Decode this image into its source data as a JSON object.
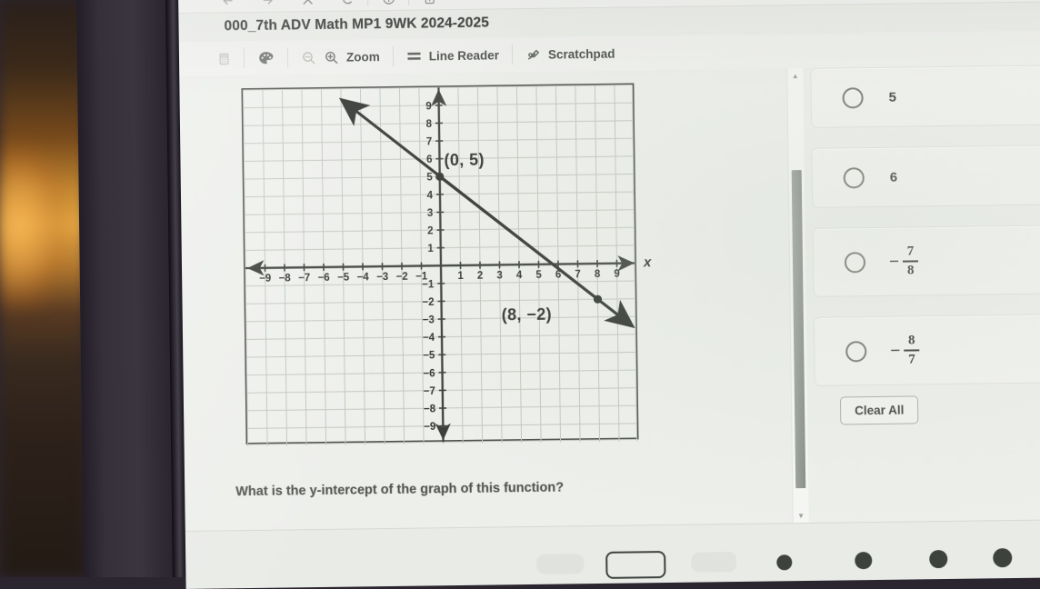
{
  "browser": {
    "controls": [
      {
        "name": "back-icon",
        "label": "Back"
      },
      {
        "name": "forward-icon",
        "label": "Forward"
      },
      {
        "name": "close-icon",
        "label": "Close"
      },
      {
        "name": "reload-icon",
        "label": "Reload"
      },
      {
        "name": "info-icon",
        "label": "Info"
      },
      {
        "name": "new-page-icon",
        "label": "New Page"
      }
    ]
  },
  "assessment": {
    "title": "000_7th ADV Math MP1 9WK 2024-2025"
  },
  "toolbar": {
    "calculator_icon": "calculator-icon",
    "palette_icon": "palette-icon",
    "zoom_out_icon": "zoom-out-icon",
    "zoom_in_icon": "zoom-in-icon",
    "zoom_label": "Zoom",
    "line_reader_icon": "line-reader-icon",
    "line_reader_label": "Line Reader",
    "scratchpad_icon": "scratchpad-icon",
    "scratchpad_label": "Scratchpad"
  },
  "question": {
    "text": "What is the y-intercept of the graph of this function?"
  },
  "answers": {
    "options": [
      {
        "id": "opt-5",
        "type": "plain",
        "label": "5"
      },
      {
        "id": "opt-6",
        "type": "plain",
        "label": "6"
      },
      {
        "id": "opt-78",
        "type": "fraction",
        "sign": "−",
        "numerator": "7",
        "denominator": "8",
        "label": "-7/8"
      },
      {
        "id": "opt-87",
        "type": "fraction",
        "sign": "−",
        "numerator": "8",
        "denominator": "7",
        "label": "-8/7"
      }
    ],
    "selected": null,
    "clear_all_label": "Clear All"
  },
  "chart_data": {
    "type": "line",
    "title": "",
    "xlabel": "x",
    "ylabel": "",
    "xlim": [
      -10,
      10
    ],
    "ylim": [
      -10,
      10
    ],
    "xticks": [
      -9,
      -8,
      -7,
      -6,
      -5,
      -4,
      -3,
      -2,
      -1,
      1,
      2,
      3,
      4,
      5,
      6,
      7,
      8,
      9
    ],
    "yticks": [
      9,
      8,
      7,
      6,
      5,
      4,
      3,
      2,
      1,
      -1,
      -2,
      -3,
      -4,
      -5,
      -6,
      -7,
      -8,
      -9
    ],
    "xtick_labels": [
      "−9",
      "−8",
      "−7",
      "−6",
      "−5",
      "−4",
      "−3",
      "−2",
      "−1",
      "1",
      "2",
      "3",
      "4",
      "5",
      "6",
      "7",
      "8",
      "9"
    ],
    "ytick_labels": [
      "9",
      "8",
      "7",
      "6",
      "5",
      "4",
      "3",
      "2",
      "1",
      "−1",
      "−2",
      "−3",
      "−4",
      "−5",
      "−6",
      "−7",
      "−8",
      "−9"
    ],
    "grid": true,
    "legend": false,
    "series": [
      {
        "name": "line",
        "slope": -0.875,
        "intercept": 5,
        "points": [
          {
            "x": 0,
            "y": 5
          },
          {
            "x": 8,
            "y": -2
          }
        ],
        "arrows": "both",
        "color": "#2e312d"
      }
    ],
    "annotations": [
      {
        "text": "(0, 5)",
        "x": 0,
        "y": 5,
        "placement": "right-above"
      },
      {
        "text": "(8, −2)",
        "x": 8,
        "y": -2,
        "placement": "left-below"
      }
    ],
    "axis_arrow_labels": {
      "x": "x"
    }
  },
  "scrollbar": {
    "up_arrow": "▲",
    "down_arrow": "▼"
  }
}
